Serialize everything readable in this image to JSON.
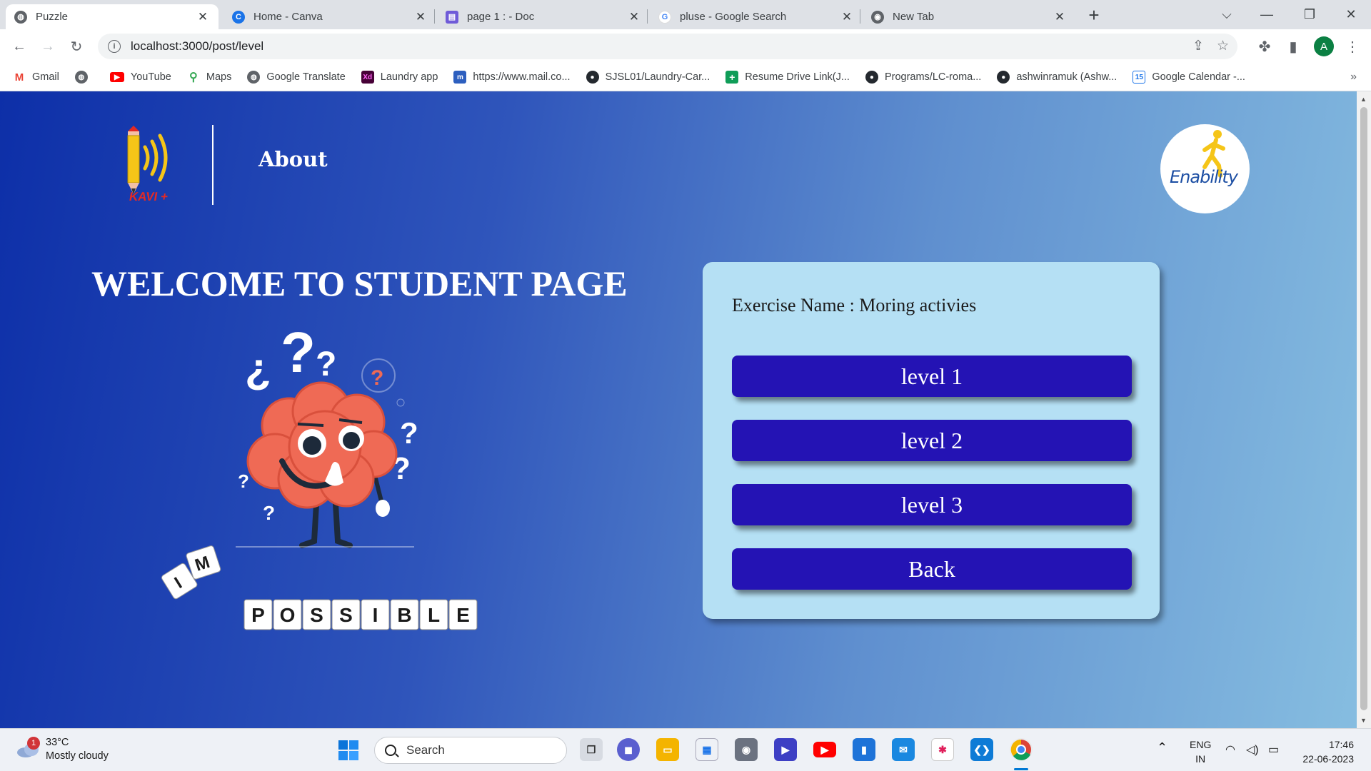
{
  "browser": {
    "tabs": [
      {
        "title": "Puzzle",
        "icon": "globe-icon",
        "active": true
      },
      {
        "title": "Home - Canva",
        "icon": "canva-icon",
        "active": false
      },
      {
        "title": "page 1 : - Doc",
        "icon": "doc-icon",
        "active": false
      },
      {
        "title": "pluse - Google Search",
        "icon": "google-icon",
        "active": false
      },
      {
        "title": "New Tab",
        "icon": "chrome-icon",
        "active": false
      }
    ],
    "url": "localhost:3000/post/level",
    "profile_initial": "A",
    "bookmarks": [
      {
        "label": "Gmail",
        "icon": "gmail-icon"
      },
      {
        "label": "",
        "icon": "globe-icon"
      },
      {
        "label": "YouTube",
        "icon": "youtube-icon"
      },
      {
        "label": "Maps",
        "icon": "maps-icon"
      },
      {
        "label": "Google Translate",
        "icon": "globe-icon"
      },
      {
        "label": "Laundry app",
        "icon": "xd-icon"
      },
      {
        "label": "https://www.mail.co...",
        "icon": "mail-icon"
      },
      {
        "label": "SJSL01/Laundry-Car...",
        "icon": "github-icon"
      },
      {
        "label": "Resume Drive Link(J...",
        "icon": "sheets-icon"
      },
      {
        "label": "Programs/LC-roma...",
        "icon": "github-icon"
      },
      {
        "label": "ashwinramuk (Ashw...",
        "icon": "github-icon"
      },
      {
        "label": "Google Calendar -...",
        "icon": "calendar-icon"
      }
    ],
    "bookmarks_more": "»"
  },
  "page": {
    "nav_about": "About",
    "logo_text": "KAVI +",
    "partner_logo_text": "Enability",
    "welcome_heading": "WELCOME TO STUDENT PAGE",
    "illustration_letters_top": [
      "I",
      "M"
    ],
    "illustration_letters": [
      "P",
      "O",
      "S",
      "S",
      "I",
      "B",
      "L",
      "E"
    ],
    "exercise_name": "Exercise Name : Moring activies",
    "buttons": {
      "level1": "level 1",
      "level2": "level 2",
      "level3": "level 3",
      "back": "Back"
    }
  },
  "taskbar": {
    "weather_temp": "33°C",
    "weather_desc": "Mostly cloudy",
    "weather_badge": "1",
    "search_label": "Search",
    "lang_top": "ENG",
    "lang_bottom": "IN",
    "time": "17:46",
    "date": "22-06-2023",
    "colors": {
      "accent": "#0078d4"
    }
  },
  "colors": {
    "card_bg": "#b5e0f4",
    "button_bg": "#2413b4",
    "gradient_start": "#0d2fa8",
    "gradient_end": "#86bde0"
  }
}
